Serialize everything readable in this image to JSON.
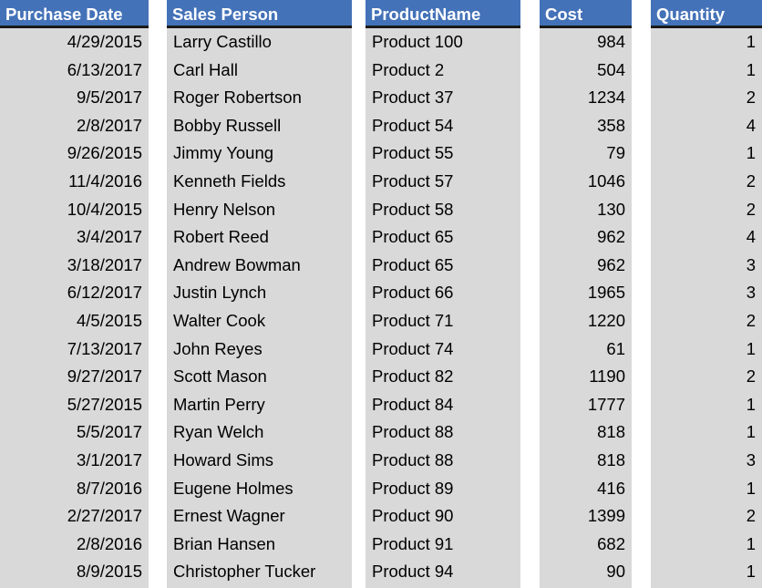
{
  "table": {
    "columns": [
      {
        "id": "purchase_date",
        "header": "Purchase Date",
        "align": "right"
      },
      {
        "id": "sales_person",
        "header": "Sales Person",
        "align": "left"
      },
      {
        "id": "product_name",
        "header": "ProductName",
        "align": "left"
      },
      {
        "id": "cost",
        "header": "Cost",
        "align": "right"
      },
      {
        "id": "quantity",
        "header": "Quantity",
        "align": "right"
      }
    ],
    "colors": {
      "header_background": "#4472B8",
      "header_text": "#FFFFFF",
      "cell_background": "#D9D9D9",
      "cell_text": "#000000",
      "gutter": "#FFFFFF",
      "header_rule": "#1A1A1A"
    },
    "row_count": 20,
    "rows": [
      {
        "purchase_date": "4/29/2015",
        "sales_person": "Larry Castillo",
        "product_name": "Product 100",
        "cost": "984",
        "quantity": "1"
      },
      {
        "purchase_date": "6/13/2017",
        "sales_person": "Carl Hall",
        "product_name": "Product 2",
        "cost": "504",
        "quantity": "1"
      },
      {
        "purchase_date": "9/5/2017",
        "sales_person": "Roger Robertson",
        "product_name": "Product 37",
        "cost": "1234",
        "quantity": "2"
      },
      {
        "purchase_date": "2/8/2017",
        "sales_person": "Bobby Russell",
        "product_name": "Product 54",
        "cost": "358",
        "quantity": "4"
      },
      {
        "purchase_date": "9/26/2015",
        "sales_person": "Jimmy Young",
        "product_name": "Product 55",
        "cost": "79",
        "quantity": "1"
      },
      {
        "purchase_date": "11/4/2016",
        "sales_person": "Kenneth Fields",
        "product_name": "Product 57",
        "cost": "1046",
        "quantity": "2"
      },
      {
        "purchase_date": "10/4/2015",
        "sales_person": "Henry Nelson",
        "product_name": "Product 58",
        "cost": "130",
        "quantity": "2"
      },
      {
        "purchase_date": "3/4/2017",
        "sales_person": "Robert Reed",
        "product_name": "Product 65",
        "cost": "962",
        "quantity": "4"
      },
      {
        "purchase_date": "3/18/2017",
        "sales_person": "Andrew Bowman",
        "product_name": "Product 65",
        "cost": "962",
        "quantity": "3"
      },
      {
        "purchase_date": "6/12/2017",
        "sales_person": "Justin Lynch",
        "product_name": "Product 66",
        "cost": "1965",
        "quantity": "3"
      },
      {
        "purchase_date": "4/5/2015",
        "sales_person": "Walter Cook",
        "product_name": "Product 71",
        "cost": "1220",
        "quantity": "2"
      },
      {
        "purchase_date": "7/13/2017",
        "sales_person": "John Reyes",
        "product_name": "Product 74",
        "cost": "61",
        "quantity": "1"
      },
      {
        "purchase_date": "9/27/2017",
        "sales_person": "Scott Mason",
        "product_name": "Product 82",
        "cost": "1190",
        "quantity": "2"
      },
      {
        "purchase_date": "5/27/2015",
        "sales_person": "Martin Perry",
        "product_name": "Product 84",
        "cost": "1777",
        "quantity": "1"
      },
      {
        "purchase_date": "5/5/2017",
        "sales_person": "Ryan Welch",
        "product_name": "Product 88",
        "cost": "818",
        "quantity": "1"
      },
      {
        "purchase_date": "3/1/2017",
        "sales_person": "Howard Sims",
        "product_name": "Product 88",
        "cost": "818",
        "quantity": "3"
      },
      {
        "purchase_date": "8/7/2016",
        "sales_person": "Eugene Holmes",
        "product_name": "Product 89",
        "cost": "416",
        "quantity": "1"
      },
      {
        "purchase_date": "2/27/2017",
        "sales_person": "Ernest Wagner",
        "product_name": "Product 90",
        "cost": "1399",
        "quantity": "2"
      },
      {
        "purchase_date": "2/8/2016",
        "sales_person": "Brian Hansen",
        "product_name": "Product 91",
        "cost": "682",
        "quantity": "1"
      },
      {
        "purchase_date": "8/9/2015",
        "sales_person": "Christopher Tucker",
        "product_name": "Product 94",
        "cost": "90",
        "quantity": "1"
      }
    ]
  }
}
